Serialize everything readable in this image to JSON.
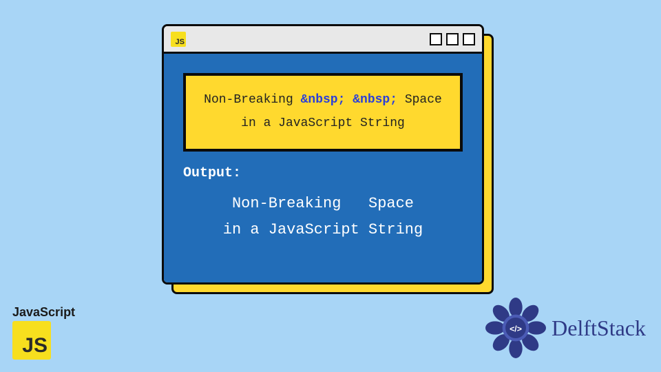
{
  "colors": {
    "page_bg": "#a8d5f6",
    "window_blue": "#226db8",
    "accent_yellow": "#ffd92e",
    "js_yellow": "#f7df1e",
    "entity_blue": "#2b3fd9",
    "delft_blue": "#2f3a86",
    "border": "#0b0b0b"
  },
  "titlebar": {
    "js_badge_text": "JS",
    "window_boxes": 3
  },
  "code_box": {
    "seg1": "Non-Breaking ",
    "entity1": "&nbsp;",
    "seg2": " ",
    "entity2": "&nbsp;",
    "seg3": " Space",
    "line2": "in a JavaScript String"
  },
  "output": {
    "label": "Output:",
    "line1": "Non-Breaking   Space",
    "line2": "in a JavaScript String"
  },
  "corner_js": {
    "label": "JavaScript",
    "badge_text": "JS"
  },
  "delft": {
    "brand": "DelftStack",
    "code_symbol": "</>"
  }
}
